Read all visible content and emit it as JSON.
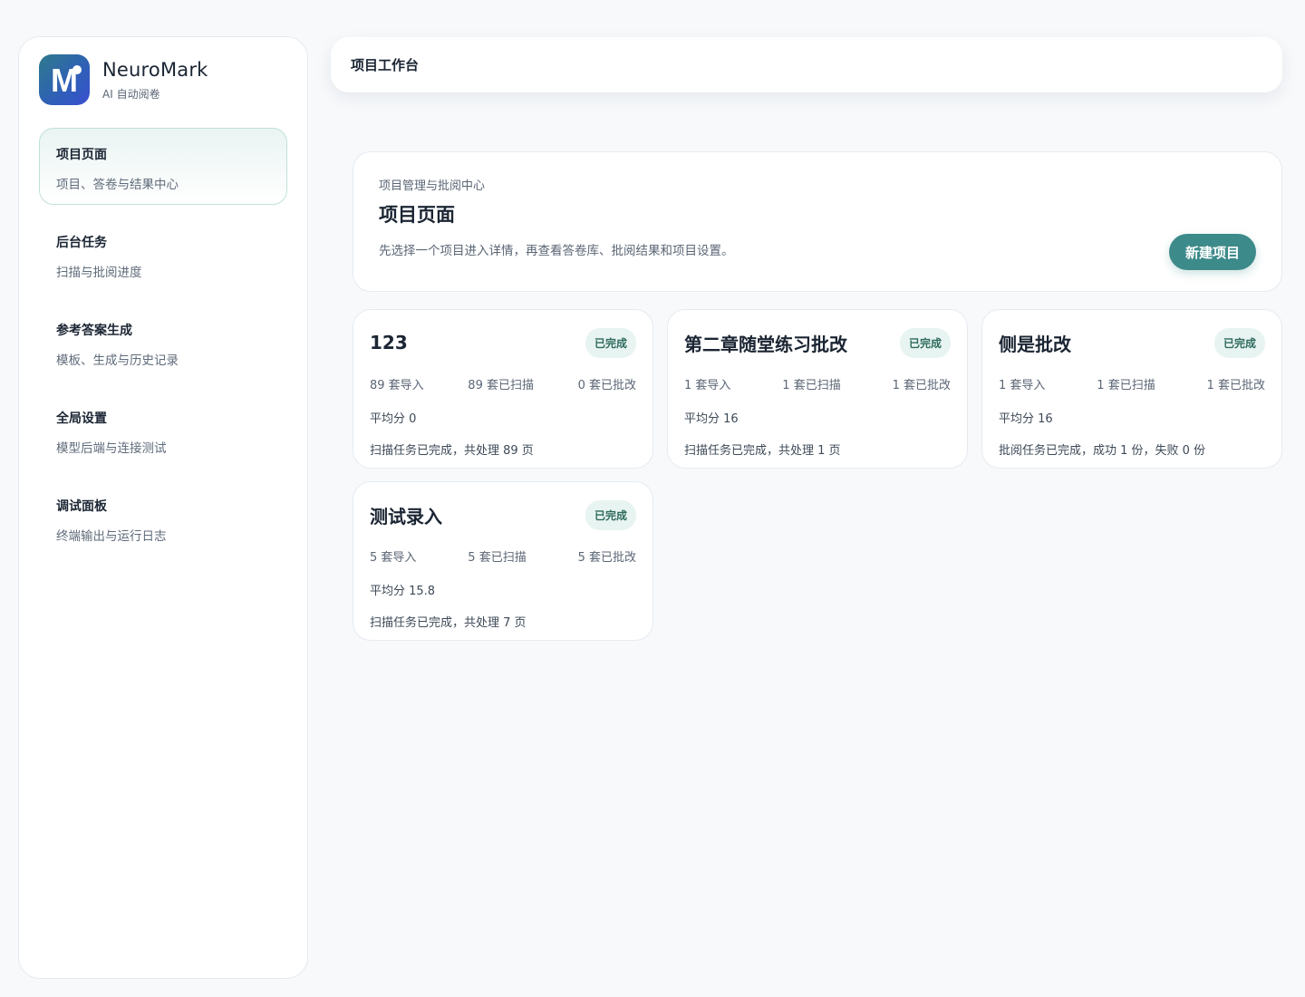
{
  "brand": {
    "name": "NeuroMark",
    "subtitle": "AI 自动阅卷",
    "logo_icon": "m-logo-icon",
    "logo_letter": "M"
  },
  "sidebar": {
    "items": [
      {
        "title": "项目页面",
        "desc": "项目、答卷与结果中心",
        "active": true
      },
      {
        "title": "后台任务",
        "desc": "扫描与批阅进度",
        "active": false
      },
      {
        "title": "参考答案生成",
        "desc": "模板、生成与历史记录",
        "active": false
      },
      {
        "title": "全局设置",
        "desc": "模型后端与连接测试",
        "active": false
      },
      {
        "title": "调试面板",
        "desc": "终端输出与运行日志",
        "active": false
      }
    ]
  },
  "topbar": {
    "title": "项目工作台"
  },
  "hero": {
    "eyebrow": "项目管理与批阅中心",
    "title": "项目页面",
    "desc": "先选择一个项目进入详情，再查看答卷库、批阅结果和项目设置。",
    "new_button": "新建项目"
  },
  "projects": [
    {
      "name": "123",
      "status": "已完成",
      "imported": "89 套导入",
      "scanned": "89 套已扫描",
      "graded": "0 套已批改",
      "avg": "平均分 0",
      "detail": "扫描任务已完成，共处理 89 页"
    },
    {
      "name": "第二章随堂练习批改",
      "status": "已完成",
      "imported": "1 套导入",
      "scanned": "1 套已扫描",
      "graded": "1 套已批改",
      "avg": "平均分 16",
      "detail": "扫描任务已完成，共处理 1 页"
    },
    {
      "name": "侧是批改",
      "status": "已完成",
      "imported": "1 套导入",
      "scanned": "1 套已扫描",
      "graded": "1 套已批改",
      "avg": "平均分 16",
      "detail": "批阅任务已完成，成功 1 份，失败 0 份"
    },
    {
      "name": "测试录入",
      "status": "已完成",
      "imported": "5 套导入",
      "scanned": "5 套已扫描",
      "graded": "5 套已批改",
      "avg": "平均分 15.8",
      "detail": "扫描任务已完成，共处理 7 页"
    }
  ],
  "colors": {
    "accent": "#3d8a8a",
    "badge_bg": "#e8f4f1",
    "badge_text": "#2f6b5e"
  }
}
